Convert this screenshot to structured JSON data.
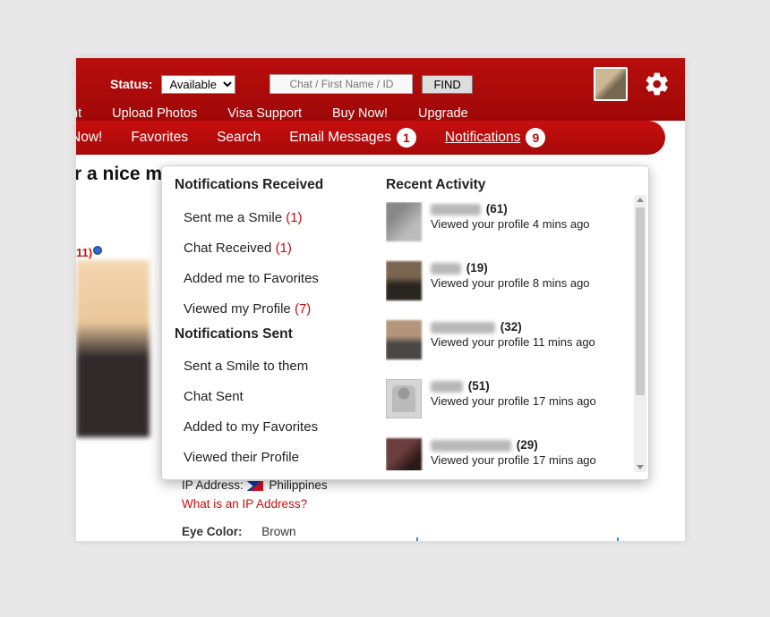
{
  "topbar": {
    "status_label": "Status:",
    "status_value": "Available",
    "search_placeholder": "Chat / First Name / ID",
    "find_label": "FIND",
    "row2": [
      "nt",
      "Upload Photos",
      "Visa Support",
      "Buy Now!",
      "Upgrade"
    ]
  },
  "nav": {
    "items": [
      {
        "label": "Now!"
      },
      {
        "label": "Favorites"
      },
      {
        "label": "Search"
      },
      {
        "label": "Email Messages",
        "badge": "1"
      },
      {
        "label": "Notifications",
        "badge": "9",
        "active": true
      }
    ]
  },
  "behind": {
    "title_fragment": "r a nice ma",
    "count_fragment": "11)",
    "ip_label": "IP Address:",
    "ip_country": "Philippines",
    "ip_link": "What is an IP Address?",
    "eye_label": "Eye Color:",
    "eye_value": "Brown"
  },
  "dropdown": {
    "received_header": "Notifications Received",
    "received": [
      {
        "label": "Sent me a Smile",
        "count": "(1)"
      },
      {
        "label": "Chat Received",
        "count": "(1)"
      },
      {
        "label": "Added me to Favorites",
        "count": ""
      },
      {
        "label": "Viewed my Profile",
        "count": "(7)"
      }
    ],
    "sent_header": "Notifications Sent",
    "sent": [
      {
        "label": "Sent a Smile to them"
      },
      {
        "label": "Chat Sent"
      },
      {
        "label": "Added to my Favorites"
      },
      {
        "label": "Viewed their Profile"
      }
    ],
    "recent_header": "Recent Activity",
    "activity": [
      {
        "age": "(61)",
        "sub": "Viewed your profile 4 mins ago"
      },
      {
        "age": "(19)",
        "sub": "Viewed your profile 8 mins ago"
      },
      {
        "age": "(32)",
        "sub": "Viewed your profile 11 mins ago"
      },
      {
        "age": "(51)",
        "sub": "Viewed your profile 17 mins ago"
      },
      {
        "age": "(29)",
        "sub": "Viewed your profile 17 mins ago"
      }
    ]
  }
}
